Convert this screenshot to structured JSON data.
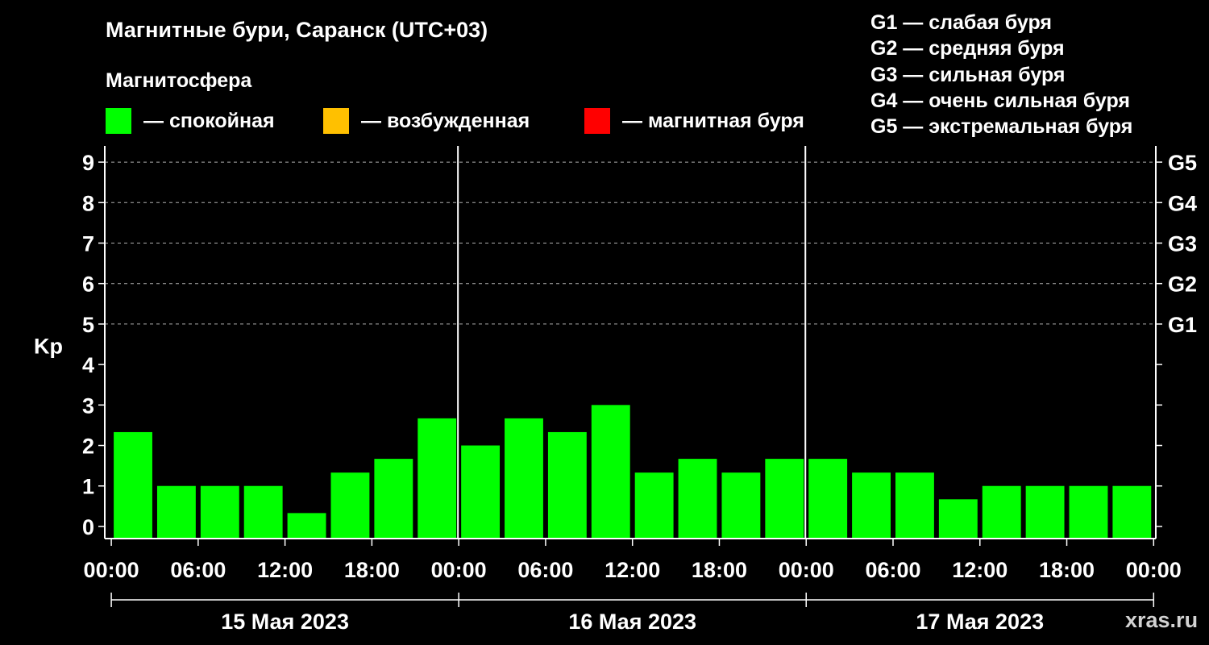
{
  "title": "Магнитные бури, Саранск (UTC+03)",
  "subtitle": "Магнитосфера",
  "legend": [
    {
      "color": "#00ff00",
      "label": "— спокойная"
    },
    {
      "color": "#ffc000",
      "label": "— возбужденная"
    },
    {
      "color": "#ff0000",
      "label": "— магнитная буря"
    }
  ],
  "g_legend": [
    "G1 — слабая буря",
    "G2 — средняя буря",
    "G3 — сильная буря",
    "G4 — очень сильная буря",
    "G5 — экстремальная буря"
  ],
  "watermark": "xras.ru",
  "chart_data": {
    "type": "bar",
    "ylabel": "Kp",
    "ylim": [
      -0.3,
      9.4
    ],
    "yticks": [
      0,
      1,
      2,
      3,
      4,
      5,
      6,
      7,
      8,
      9
    ],
    "g_scale": [
      {
        "level": 5,
        "label": "G1"
      },
      {
        "level": 6,
        "label": "G2"
      },
      {
        "level": 7,
        "label": "G3"
      },
      {
        "level": 8,
        "label": "G4"
      },
      {
        "level": 9,
        "label": "G5"
      }
    ],
    "x_tick_labels": [
      "00:00",
      "06:00",
      "12:00",
      "18:00",
      "00:00",
      "06:00",
      "12:00",
      "18:00",
      "00:00",
      "06:00",
      "12:00",
      "18:00",
      "00:00"
    ],
    "days": [
      "15 Мая 2023",
      "16 Мая 2023",
      "17 Мая 2023"
    ],
    "grid": "dashed horizontal at 5-9",
    "series": [
      {
        "color": "#00ff00",
        "values": [
          2.33,
          1.0,
          1.0,
          1.0,
          0.33,
          1.33,
          1.67,
          2.67,
          2.0,
          2.67,
          2.33,
          3.0,
          1.33,
          1.67,
          1.33,
          1.67,
          1.67,
          1.33,
          1.33,
          0.67,
          1.0,
          1.0,
          1.0,
          1.0
        ]
      }
    ]
  }
}
